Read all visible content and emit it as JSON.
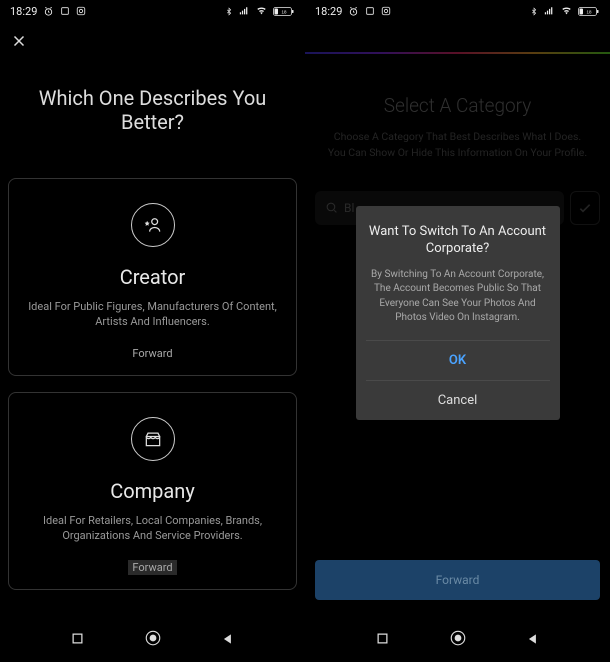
{
  "status": {
    "time": "18:29",
    "battery": "18"
  },
  "screen1": {
    "title": "Which One Describes You Better?",
    "cards": [
      {
        "title": "Creator",
        "desc": "Ideal For Public Figures, Manufacturers Of Content, Artists And Influencers.",
        "forward": "Forward"
      },
      {
        "title": "Company",
        "desc": "Ideal For Retailers, Local Companies, Brands, Organizations And Service Providers.",
        "forward": "Forward"
      }
    ]
  },
  "screen2": {
    "title": "Select A Category",
    "desc_line1": "Choose A Category That Best Describes What I Does.",
    "desc_line2": "You Can Show Or Hide This Information On Your Profile.",
    "search_placeholder": "Bl",
    "forward_btn": "Forward"
  },
  "dialog": {
    "title_line1": "Want To Switch To An Account",
    "title_line2": "Corporate?",
    "body": "By Switching To An Account Corporate, The Account Becomes Public So That Everyone Can See Your Photos And Photos Video On Instagram.",
    "ok": "OK",
    "cancel": "Cancel"
  }
}
